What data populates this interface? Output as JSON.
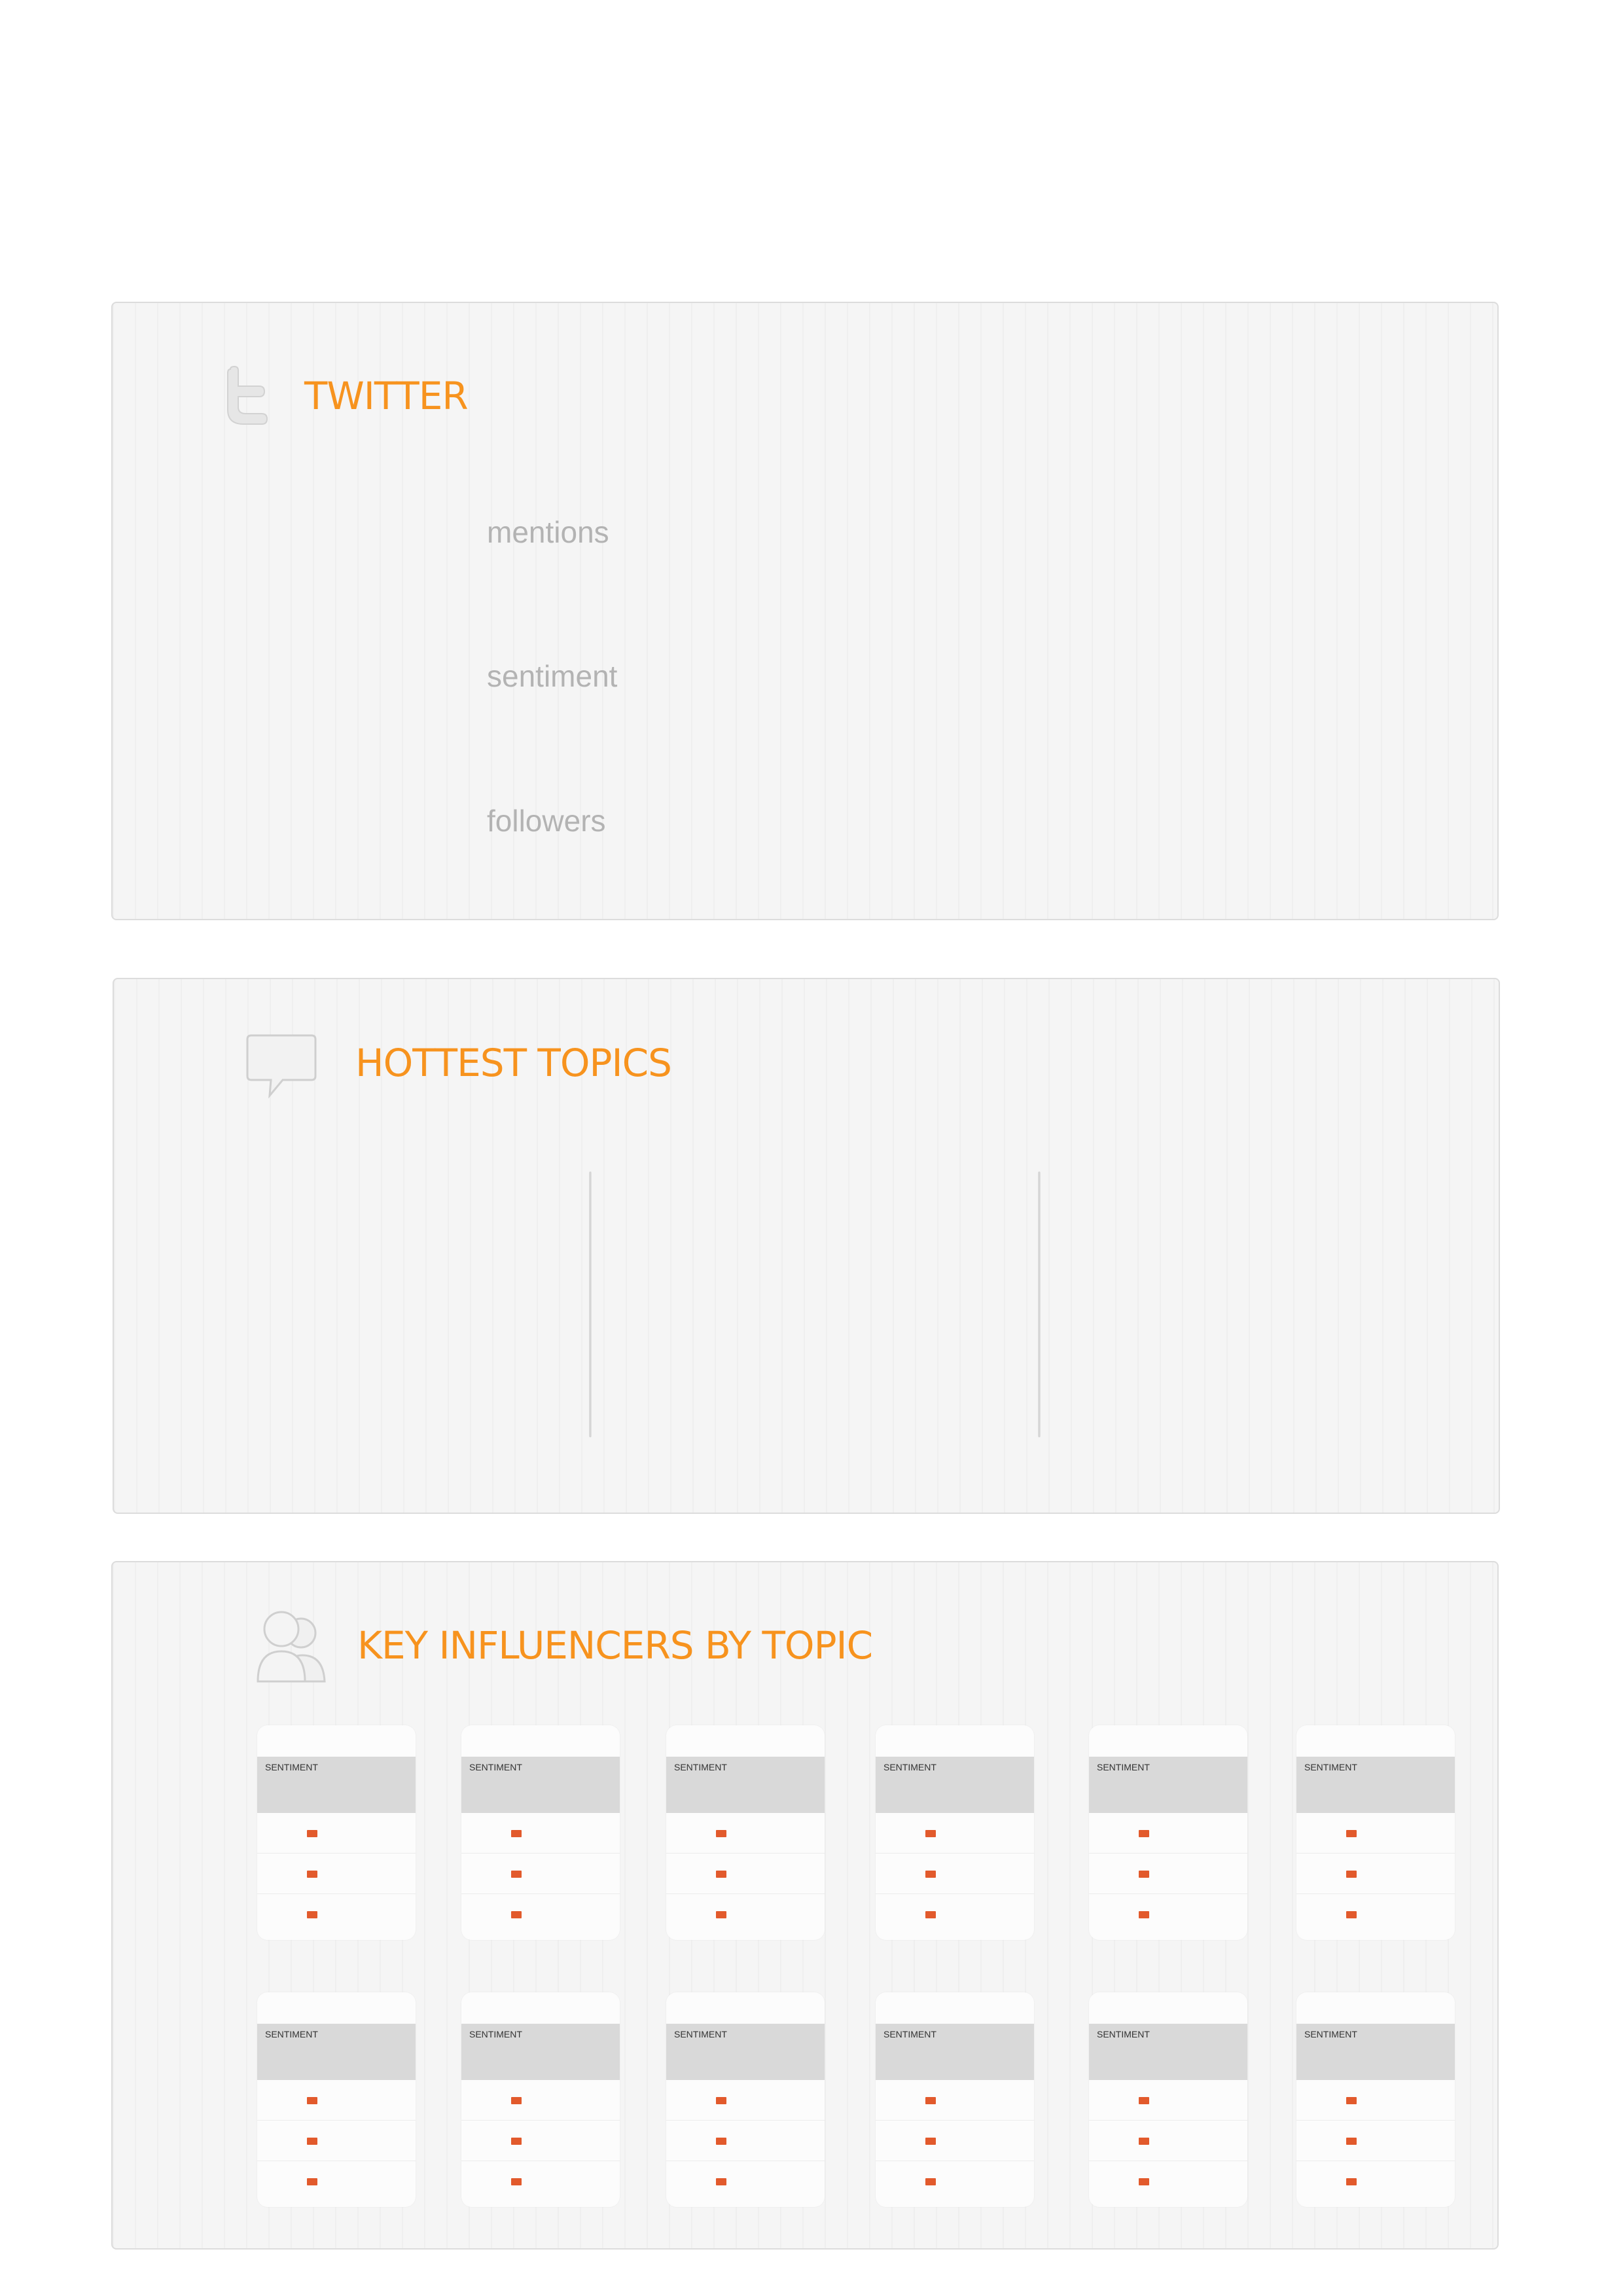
{
  "colors": {
    "accent": "#f7931e",
    "label_gray": "#b3b3b3",
    "panel_bg": "#f5f5f5",
    "card_header": "#d9d9d9",
    "badge": "#e25a2c"
  },
  "twitter": {
    "title": "TWITTER",
    "icon": "twitter-bird-icon",
    "metrics": [
      {
        "label": "mentions"
      },
      {
        "label": "sentiment"
      },
      {
        "label": "followers"
      }
    ]
  },
  "topics": {
    "title": "HOTTEST TOPICS",
    "icon": "speech-bubble-icon"
  },
  "influencers": {
    "title": "KEY INFLUENCERS BY TOPIC",
    "icon": "users-icon",
    "card_header_label": "SENTIMENT",
    "row_badge_icon": "flag-icon",
    "row_badge_text": ""
  }
}
